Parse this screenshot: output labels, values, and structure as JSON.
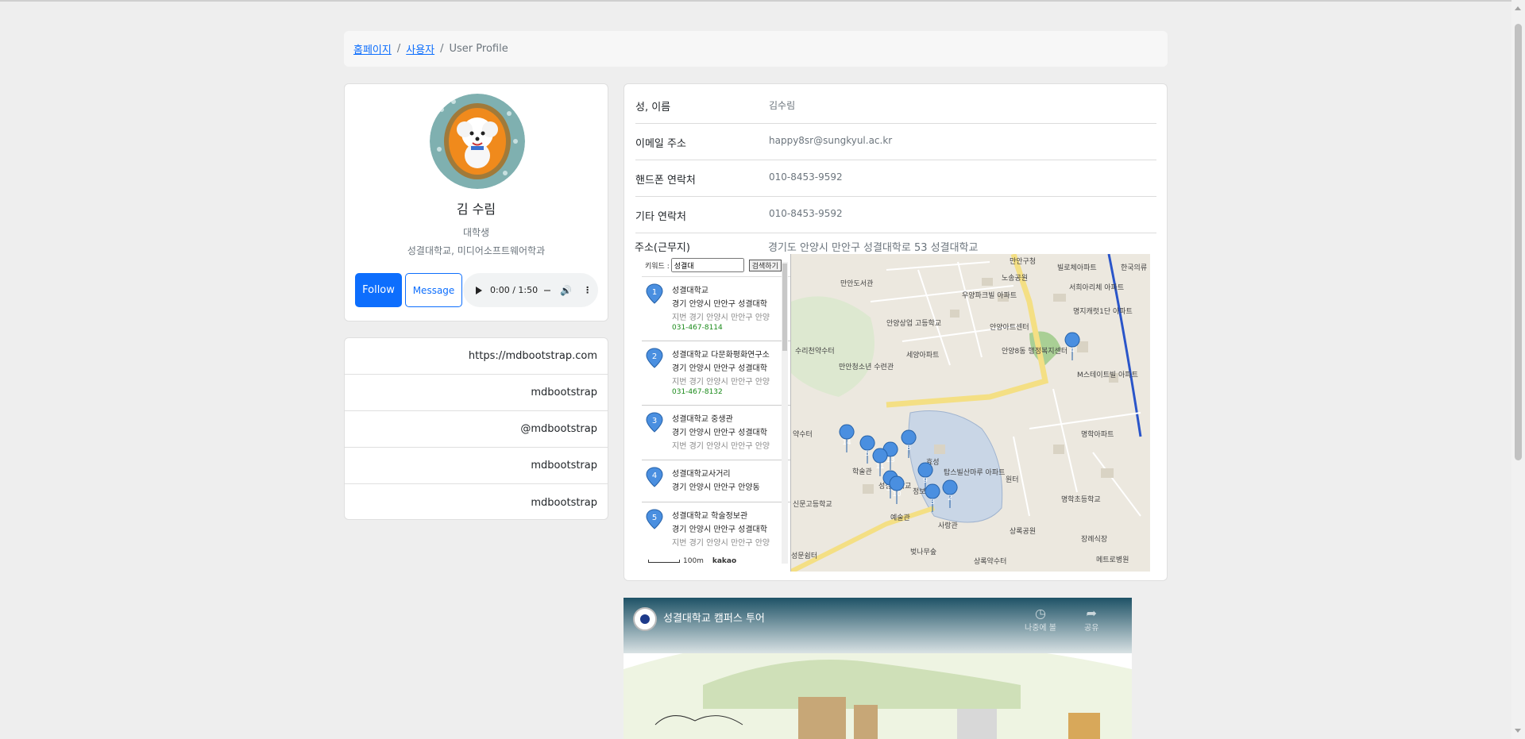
{
  "breadcrumb": {
    "home": "홈페이지",
    "users": "사용자",
    "current": "User Profile"
  },
  "profile": {
    "name": "김 수림",
    "role": "대학생",
    "school": "성결대학교, 미디어소프트웨어학과",
    "follow_label": "Follow",
    "message_label": "Message",
    "audio_time": "0:00 / 1:50"
  },
  "links": [
    {
      "text": "https://mdbootstrap.com",
      "icon": "globe-icon"
    },
    {
      "text": "mdbootstrap",
      "icon": "github-icon"
    },
    {
      "text": "@mdbootstrap",
      "icon": "twitter-icon"
    },
    {
      "text": "mdbootstrap",
      "icon": "instagram-icon"
    },
    {
      "text": "mdbootstrap",
      "icon": "facebook-icon"
    }
  ],
  "info": {
    "name_label": "성, 이름",
    "name_value": "김수림",
    "email_label": "이메일 주소",
    "email_value": "happy8sr@sungkyul.ac.kr",
    "phone_label": "핸드폰 연락처",
    "phone_value": "010-8453-9592",
    "other_label": "기타 연락처",
    "other_value": "010-8453-9592",
    "address_label": "주소(근무지)",
    "address_value": "경기도 안양시 만안구 성결대학로 53 성결대학교"
  },
  "map": {
    "keyword_label": "키워드 :",
    "keyword_value": "성결대",
    "search_button": "검색하기",
    "results": [
      {
        "num": "1",
        "name": "성결대학교",
        "addr": "경기 안양시 만안구 성결대학",
        "jibun": "경기 안양시 만안구 안양",
        "phone": "031-467-8114"
      },
      {
        "num": "2",
        "name": "성결대학교 다문화평화연구소",
        "addr": "경기 안양시 만안구 성결대학",
        "jibun": "경기 안양시 만안구 안양",
        "phone": "031-467-8132"
      },
      {
        "num": "3",
        "name": "성결대학교 중생관",
        "addr": "경기 안양시 만안구 성결대학",
        "jibun": "경기 안양시 만안구 안양",
        "phone": ""
      },
      {
        "num": "4",
        "name": "성결대학교사거리",
        "addr": "경기 안양시 만안구 안양동",
        "jibun": "",
        "phone": ""
      },
      {
        "num": "5",
        "name": "성결대학교 학술정보관",
        "addr": "경기 안양시 만안구 성결대학",
        "jibun": "경기 안양시 만안구 안양",
        "phone": ""
      }
    ],
    "jibun_tag": "지번",
    "scale": "100m",
    "brand": "kakao",
    "places": [
      "만안구청",
      "빌로체아파트",
      "한국의류",
      "노송공원",
      "서희아리체 아파트",
      "만안도서관",
      "우양파크빌 아파트",
      "명지캐럿1단 아파트",
      "안양상업 고등학교",
      "안양아트센터",
      "수리천약수터",
      "안양8동 행정복지센터",
      "만안청소년 수련관",
      "세양아파트",
      "M스테이트빌 아파트",
      "약수터",
      "명학아파트",
      "학술관",
      "성결대학교",
      "효성",
      "탑스빌산마루 아파트",
      "원터",
      "명학초등학교",
      "신문고등학교",
      "정보관",
      "예술관",
      "사랑관",
      "상록공원",
      "장례식장",
      "벚나무숲",
      "상록약수터",
      "성문쉼터",
      "메트로병원"
    ],
    "markers": [
      "14",
      "5",
      "13",
      "8",
      "11",
      "9",
      "15",
      "10",
      "3",
      "2",
      "4"
    ]
  },
  "video": {
    "title": "성결대학교 캠퍼스 투어",
    "watch_later": "나중에 볼",
    "share": "공유"
  }
}
